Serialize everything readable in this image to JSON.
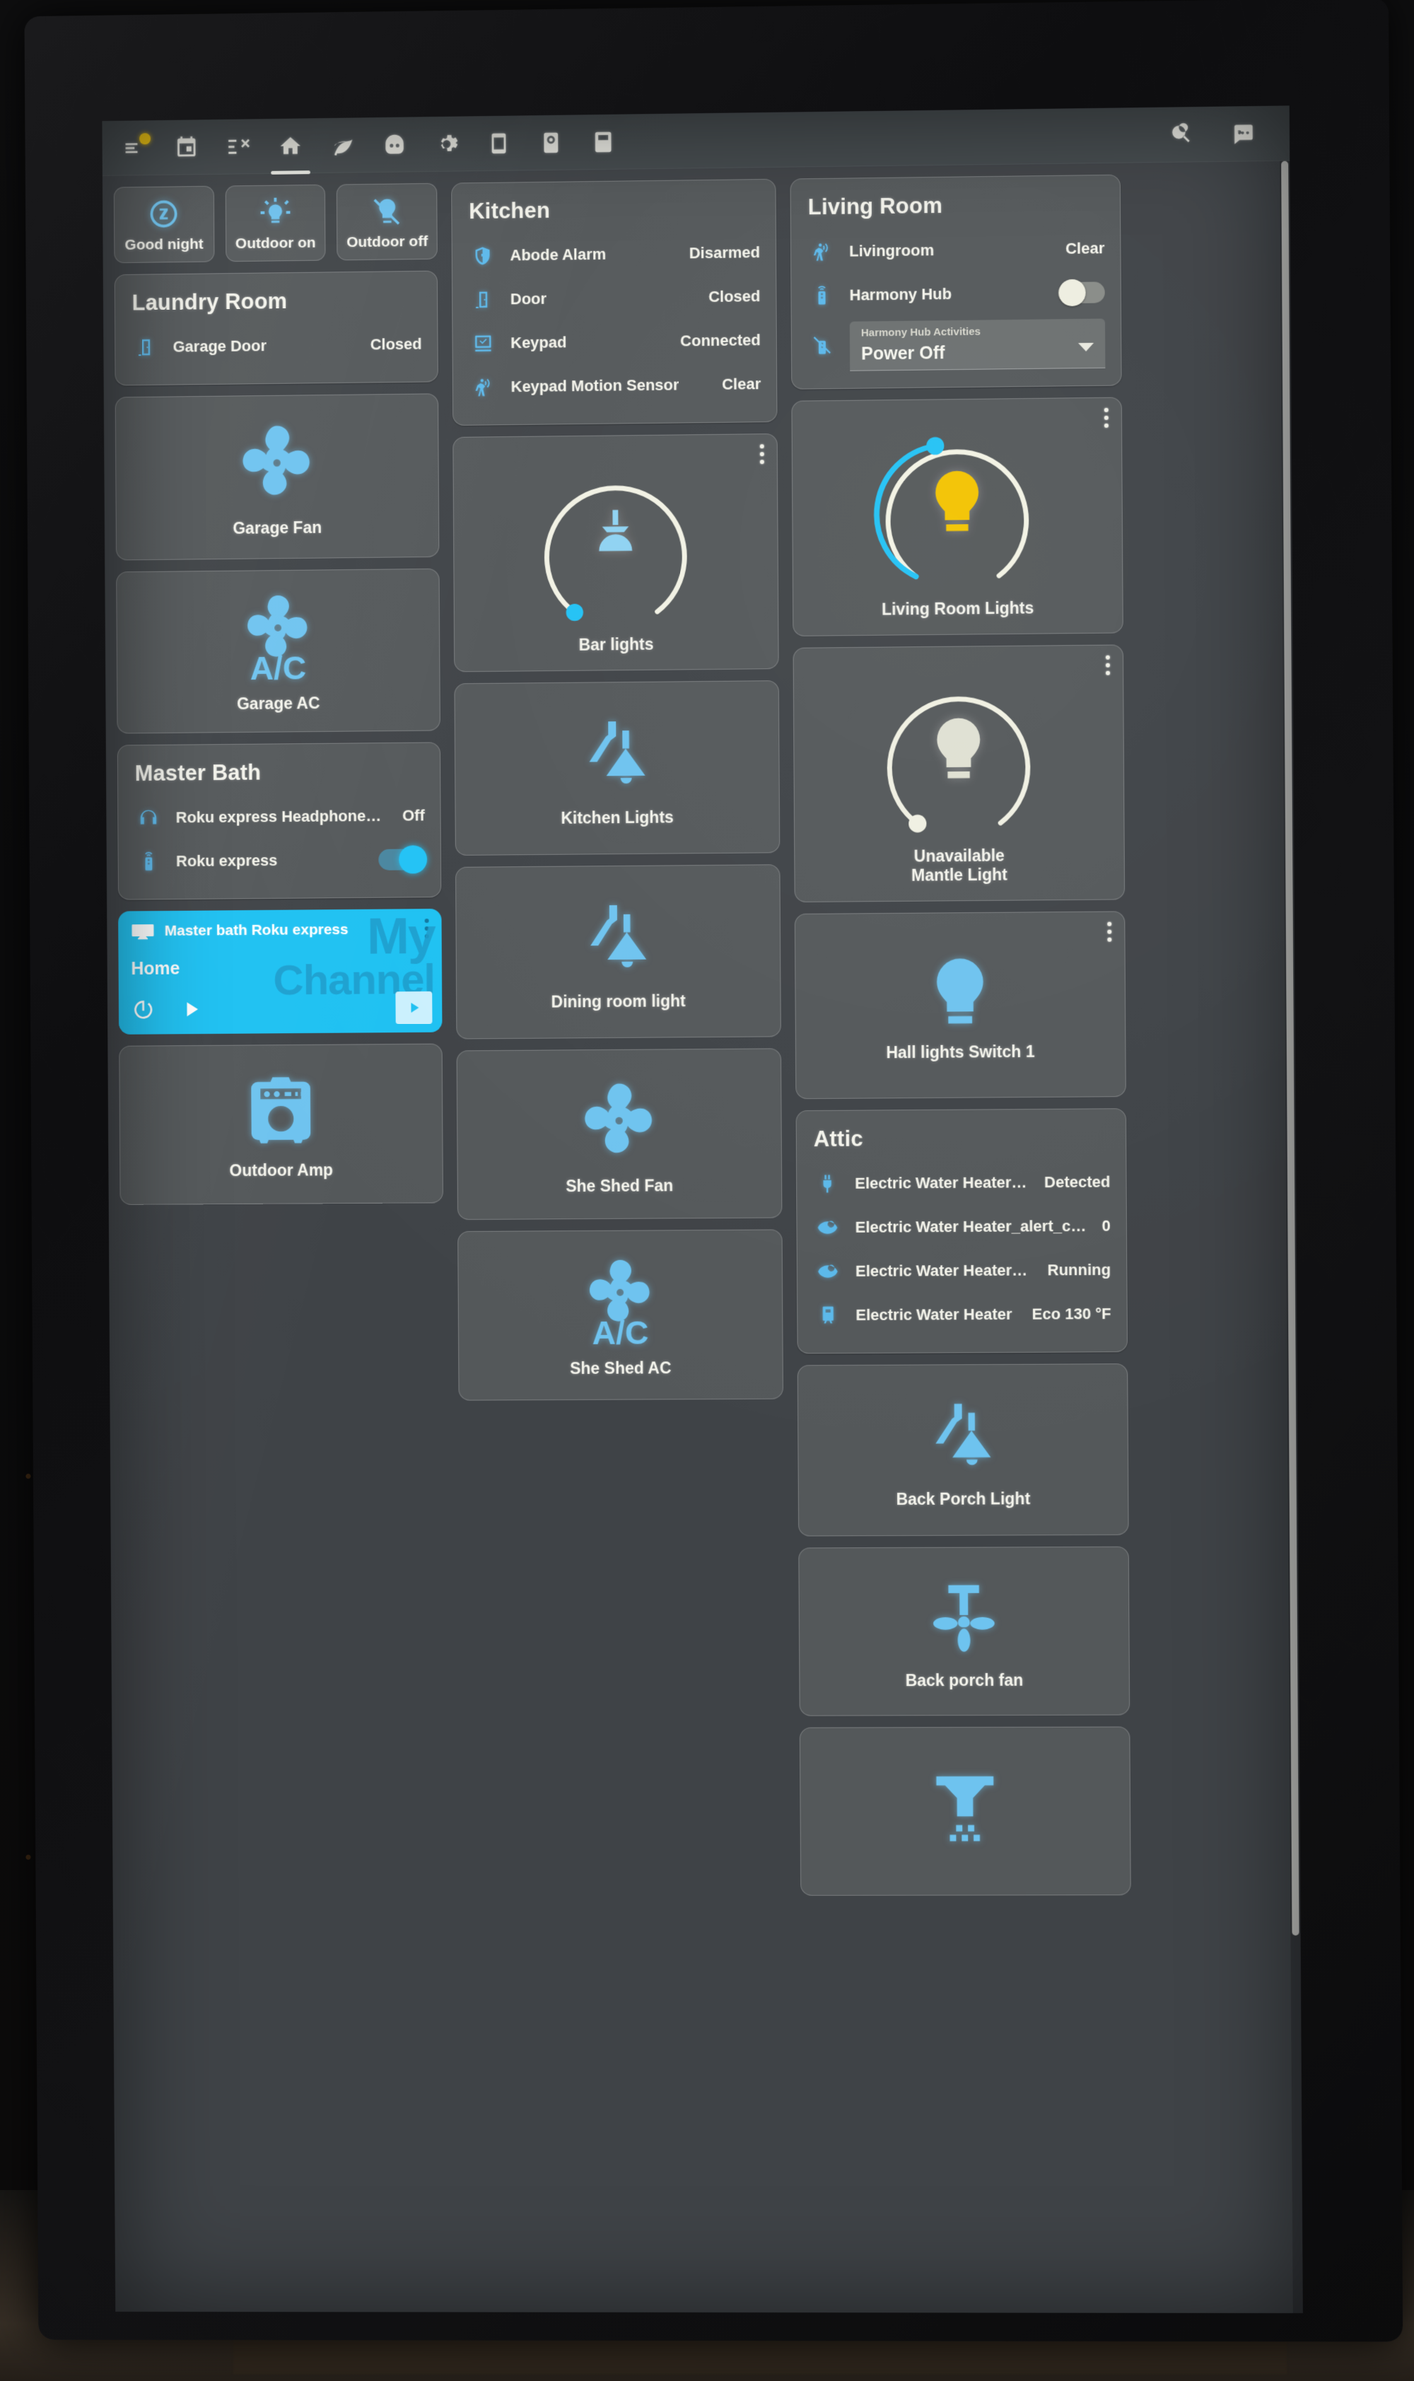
{
  "app": {
    "theme_accent": "#6ec3ef",
    "card_bg": "#54585a",
    "appbar_bg": "#43494c",
    "on_yellow": "#f2c300",
    "media_blue": "#1ec1f2"
  },
  "appbar": {
    "tabs": [
      {
        "name": "overview-tab",
        "icon": "weather-sunny-alert-icon",
        "badge": true,
        "active": false
      },
      {
        "name": "calendar-tab",
        "icon": "calendar-icon",
        "active": false
      },
      {
        "name": "shuffle-tab",
        "icon": "format-list-shuffle-icon",
        "active": false
      },
      {
        "name": "home-tab",
        "icon": "home-icon",
        "active": true
      },
      {
        "name": "leaf-tab",
        "icon": "leaf-icon",
        "active": false
      },
      {
        "name": "robot-tab",
        "icon": "robot-vacuum-icon",
        "active": false
      },
      {
        "name": "settings-tab",
        "icon": "cog-icon",
        "active": false
      },
      {
        "name": "tablet-tab",
        "icon": "tablet-dashboard-icon",
        "active": false
      },
      {
        "name": "camera-tab",
        "icon": "cctv-icon",
        "active": false
      },
      {
        "name": "remote-tab",
        "icon": "remote-tv-icon",
        "active": false
      }
    ],
    "actions": [
      {
        "name": "search-button",
        "icon": "search-icon"
      },
      {
        "name": "assist-button",
        "icon": "assist-conversation-icon"
      }
    ]
  },
  "scenes": [
    {
      "label": "Good night",
      "icon": "sleep-icon"
    },
    {
      "label": "Outdoor on",
      "icon": "lightbulb-on-icon"
    },
    {
      "label": "Outdoor off",
      "icon": "lightbulb-off-icon"
    }
  ],
  "left_column": {
    "laundry_room": {
      "title": "Laundry Room",
      "rows": [
        {
          "icon": "door-closed-icon",
          "name": "Garage Door",
          "state": "Closed"
        }
      ]
    },
    "tiles": [
      {
        "label": "Garage Fan",
        "icon": "fan-icon",
        "state": "on"
      },
      {
        "label": "Garage AC",
        "icon": "air-conditioner-icon",
        "state": "on"
      }
    ],
    "master_bath": {
      "title": "Master Bath",
      "rows": [
        {
          "icon": "headphones-icon",
          "name": "Roku express Headphones Connec…",
          "state": "Off",
          "control": "text"
        },
        {
          "icon": "remote-icon",
          "name": "Roku express",
          "state": "on",
          "control": "toggle"
        }
      ]
    },
    "media_player": {
      "name": "Master bath Roku express",
      "source": "Home",
      "brand_line1": "My",
      "brand_line2": "Channel",
      "icon": "television-icon",
      "controls": [
        "power-icon",
        "play-icon"
      ]
    },
    "amp_tile": {
      "label": "Outdoor Amp",
      "icon": "amplifier-icon",
      "state": "on"
    }
  },
  "middle_column": {
    "kitchen": {
      "title": "Kitchen",
      "rows": [
        {
          "icon": "shield-home-icon",
          "name": "Abode Alarm",
          "state": "Disarmed"
        },
        {
          "icon": "door-closed-icon",
          "name": "Door",
          "state": "Closed"
        },
        {
          "icon": "keypad-icon",
          "name": "Keypad",
          "state": "Connected"
        },
        {
          "icon": "motion-sensor-icon",
          "name": "Keypad Motion Sensor",
          "state": "Clear"
        }
      ]
    },
    "tiles": [
      {
        "label": "Bar lights",
        "icon": "ceiling-pendant-light-icon",
        "dial": true,
        "dial_value": 0,
        "state": "on"
      },
      {
        "label": "Kitchen Lights",
        "icon": "wall-sconce-icon",
        "dial": false,
        "state": "on"
      },
      {
        "label": "Dining room light",
        "icon": "wall-sconce-icon",
        "dial": false,
        "state": "on"
      },
      {
        "label": "She Shed Fan",
        "icon": "fan-icon",
        "dial": false,
        "state": "on"
      },
      {
        "label": "She Shed AC",
        "icon": "air-conditioner-icon",
        "dial": false,
        "state": "on"
      }
    ]
  },
  "right_column": {
    "living_room": {
      "title": "Living Room",
      "rows": [
        {
          "icon": "motion-sensor-icon",
          "name": "Livingroom",
          "state": "Clear",
          "control": "text"
        },
        {
          "icon": "remote-icon",
          "name": "Harmony Hub",
          "state": "off",
          "control": "toggle"
        }
      ],
      "select": {
        "icon": "remote-off-icon",
        "label": "Harmony Hub Activities",
        "value": "Power Off"
      }
    },
    "tiles": [
      {
        "label": "Living Room Lights",
        "icon": "lightbulb-icon",
        "dial": true,
        "dial_value": 35,
        "state": "on",
        "color": "#f2c300"
      },
      {
        "label": "Unavailable\nMantle Light",
        "icon": "lightbulb-icon",
        "dial": true,
        "dial_value": 0,
        "state": "unavailable",
        "color": "#dfe0d2"
      },
      {
        "label": "Hall lights Switch 1",
        "icon": "lightbulb-variant-icon",
        "dial": false,
        "state": "on"
      }
    ],
    "attic": {
      "title": "Attic",
      "rows": [
        {
          "icon": "power-plug-icon",
          "name": "Electric Water Heater_running",
          "state": "Detected"
        },
        {
          "icon": "eye-icon",
          "name": "Electric Water Heater_alert_count",
          "state": "0"
        },
        {
          "icon": "eye-icon",
          "name": "Electric Water Heater_running…",
          "state": "Running"
        },
        {
          "icon": "water-heater-icon",
          "name": "Electric Water Heater",
          "state": "Eco 130 °F"
        }
      ]
    },
    "bottom_tiles": [
      {
        "label": "Back Porch Light",
        "icon": "wall-sconce-icon",
        "state": "on"
      },
      {
        "label": "Back porch fan",
        "icon": "ceiling-fan-icon",
        "state": "on"
      },
      {
        "label": "",
        "icon": "sprinkler-icon",
        "state": "on"
      }
    ]
  }
}
